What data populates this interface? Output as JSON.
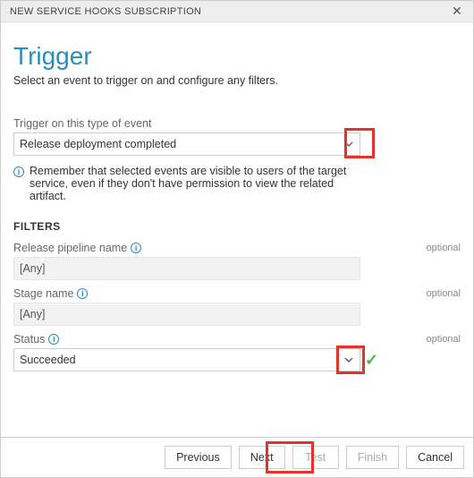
{
  "window": {
    "title": "NEW SERVICE HOOKS SUBSCRIPTION"
  },
  "header": {
    "title": "Trigger",
    "subtitle": "Select an event to trigger on and configure any filters."
  },
  "event": {
    "label": "Trigger on this type of event",
    "value": "Release deployment completed"
  },
  "remember_text": "Remember that selected events are visible to users of the target service, even if they don't have permission to view the related artifact.",
  "filters": {
    "heading": "FILTERS",
    "pipeline": {
      "label": "Release pipeline name",
      "optional": "optional",
      "value": "[Any]"
    },
    "stage": {
      "label": "Stage name",
      "optional": "optional",
      "value": "[Any]"
    },
    "status": {
      "label": "Status",
      "optional": "optional",
      "value": "Succeeded"
    }
  },
  "buttons": {
    "previous": "Previous",
    "next": "Next",
    "test": "Test",
    "finish": "Finish",
    "cancel": "Cancel"
  },
  "icons": {
    "close": "✕",
    "info": "i"
  }
}
